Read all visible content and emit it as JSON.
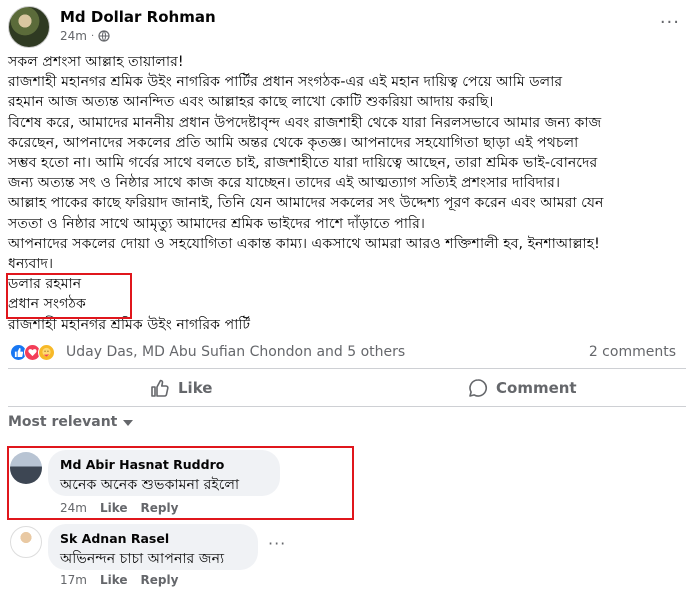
{
  "post": {
    "author": "Md Dollar Rohman",
    "time": "24m",
    "dot": "·",
    "more_glyph": "···",
    "lines": [
      "সকল প্রশংসা আল্লাহ তায়ালার!",
      "রাজশাহী মহানগর শ্রমিক উইং নাগরিক পার্টির প্রধান সংগঠক-এর এই মহান দায়িত্ব পেয়ে আমি ডলার",
      "রহমান আজ অত্যন্ত আনন্দিত এবং আল্লাহর কাছে লাখো কোটি শুকরিয়া আদায় করছি।",
      "বিশেষ করে, আমাদের মাননীয় প্রধান উপদেষ্টাবৃন্দ এবং রাজশাহী থেকে যারা নিরলসভাবে আমার জন্য কাজ",
      "করেছেন, আপনাদের সকলের প্রতি আমি অন্তর থেকে কৃতজ্ঞ। আপনাদের সহযোগিতা ছাড়া এই পথচলা",
      "সম্ভব হতো না। আমি গর্বের সাথে বলতে চাই, রাজশাহীতে যারা দায়িত্বে আছেন, তারা শ্রমিক ভাই-বোনদের",
      "জন্য অত্যন্ত সৎ ও নিষ্ঠার সাথে কাজ করে যাচ্ছেন। তাদের এই আত্মত্যাগ সত্যিই প্রশংসার দাবিদার।",
      "আল্লাহ পাকের কাছে ফরিয়াদ জানাই, তিনি যেন আমাদের সকলের সৎ উদ্দেশ্য পূরণ করেন এবং আমরা যেন",
      "সততা ও নিষ্ঠার সাথে আমৃত্যু আমাদের শ্রমিক ভাইদের পাশে দাঁড়াতে পারি।",
      "আপনাদের সকলের দোয়া ও সহযোগিতা একান্ত কাম্য। একসাথে আমরা আরও শক্তিশালী হব, ইনশাআল্লাহ!",
      "ধন্যবাদ।",
      "ডলার রহমান",
      "প্রধান সংগঠক",
      "রাজশাহী মহানগর শ্রমিক উইং নাগরিক পার্টি"
    ]
  },
  "reactions": {
    "icons": [
      "like-icon",
      "love-icon",
      "care-icon"
    ],
    "names": "Uday Das, MD Abu Sufian Chondon and 5 others",
    "comment_count": "2 comments"
  },
  "actions": {
    "like_label": "Like",
    "comment_label": "Comment"
  },
  "comments_filter": "Most relevant",
  "comments": [
    {
      "author": "Md Abir Hasnat Ruddro",
      "text": "অনেক অনেক শুভকামনা রইলো",
      "time": "24m",
      "like": "Like",
      "reply": "Reply"
    },
    {
      "author": "Sk Adnan Rasel",
      "text": "অভিনন্দন চাচা আপনার জন্য",
      "time": "17m",
      "like": "Like",
      "reply": "Reply",
      "more_glyph": "···"
    }
  ],
  "colors": {
    "highlight_box": "#e0161c",
    "like_blue": "#1877f2",
    "love_red": "#f33e58",
    "care_yellow": "#f7b928",
    "muted_text": "#65676b",
    "bubble_bg": "#f0f2f5"
  }
}
